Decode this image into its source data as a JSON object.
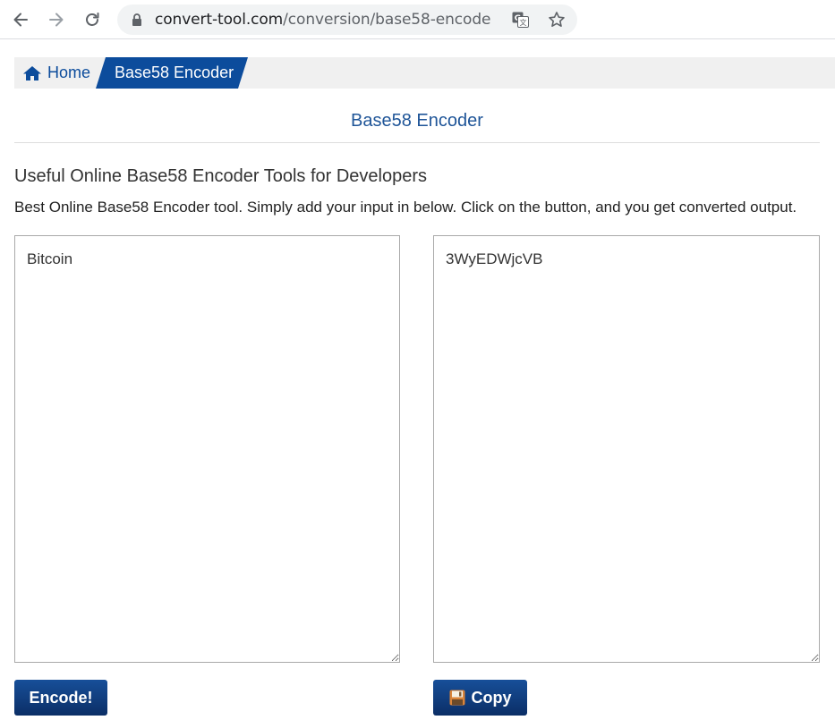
{
  "browser": {
    "url_host": "convert-tool.com",
    "url_path": "/conversion/base58-encode"
  },
  "breadcrumb": {
    "home_label": "Home",
    "current_label": "Base58 Encoder"
  },
  "main": {
    "title": "Base58 Encoder",
    "subtitle": "Useful Online Base58 Encoder Tools for Developers",
    "description": "Best Online Base58 Encoder tool. Simply add your input in below. Click on the button, and you get converted output.",
    "input_value": "Bitcoin",
    "output_value": "3WyEDWjcVB",
    "encode_button_label": "Encode!",
    "copy_button_label": "Copy"
  },
  "icons": {
    "back": "arrow-left-icon",
    "forward": "arrow-right-icon",
    "reload": "reload-icon",
    "lock": "lock-icon",
    "translate": "translate-icon",
    "bookmark": "star-icon",
    "home": "home-icon",
    "copy": "floppy-disk-icon"
  },
  "colors": {
    "accent": "#0c4c9c",
    "button": "#174f99",
    "title": "#1f5598"
  }
}
